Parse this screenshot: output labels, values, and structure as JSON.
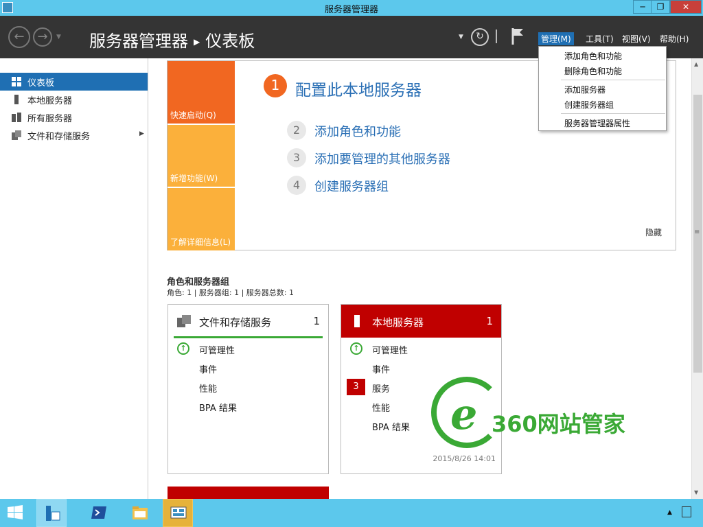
{
  "window": {
    "title": "服务器管理器"
  },
  "header": {
    "breadcrumb_root": "服务器管理器",
    "breadcrumb_current": "仪表板",
    "menus": [
      "管理(M)",
      "工具(T)",
      "视图(V)",
      "帮助(H)"
    ]
  },
  "dropdown": {
    "items": [
      "添加角色和功能",
      "删除角色和功能",
      "添加服务器",
      "创建服务器组",
      "服务器管理器属性"
    ]
  },
  "sidebar": {
    "items": [
      {
        "label": "仪表板",
        "icon": "dashboard-icon"
      },
      {
        "label": "本地服务器",
        "icon": "server-icon"
      },
      {
        "label": "所有服务器",
        "icon": "servers-icon"
      },
      {
        "label": "文件和存储服务",
        "icon": "storage-icon"
      }
    ]
  },
  "welcome": {
    "tiles": [
      "快速启动(Q)",
      "新增功能(W)",
      "了解详细信息(L)"
    ],
    "steps": [
      {
        "num": "1",
        "label": "配置此本地服务器"
      },
      {
        "num": "2",
        "label": "添加角色和功能"
      },
      {
        "num": "3",
        "label": "添加要管理的其他服务器"
      },
      {
        "num": "4",
        "label": "创建服务器组"
      }
    ],
    "hide": "隐藏"
  },
  "roles": {
    "title": "角色和服务器组",
    "summary": "角色: 1 | 服务器组: 1 | 服务器总数: 1"
  },
  "cards": [
    {
      "title": "文件和存储服务",
      "count": "1",
      "rows": [
        "可管理性",
        "事件",
        "性能",
        "BPA 结果"
      ]
    },
    {
      "title": "本地服务器",
      "count": "1",
      "rows": [
        "可管理性",
        "事件",
        "服务",
        "性能",
        "BPA 结果"
      ],
      "services_badge": "3",
      "timestamp": "2015/8/26 14:01"
    }
  ],
  "watermark": {
    "text": "360网站管家",
    "letter": "e"
  },
  "colors": {
    "accent": "#1f6fb3",
    "titlebar": "#5cc8ec",
    "header": "#343434",
    "orange": "#f16721",
    "yellow": "#fbb03b",
    "alert": "#c00000",
    "ok": "#3aa935"
  }
}
